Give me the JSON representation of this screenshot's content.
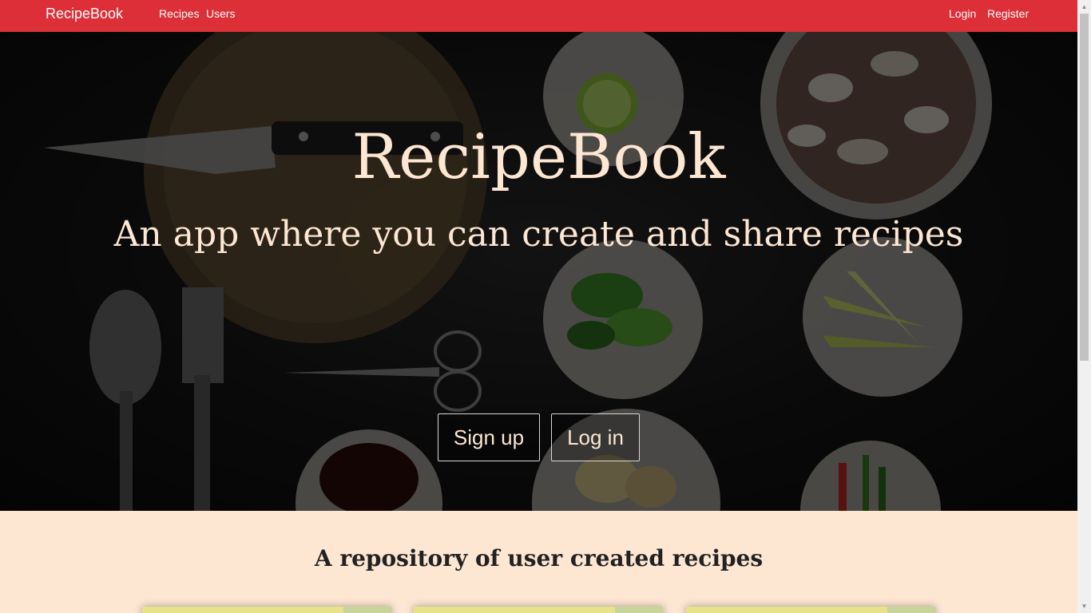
{
  "navbar": {
    "brand": "RecipeBook",
    "links": {
      "recipes": "Recipes",
      "users": "Users"
    },
    "auth": {
      "login": "Login",
      "register": "Register"
    },
    "color": "#dc2f38"
  },
  "hero": {
    "title": "RecipeBook",
    "subtitle": "An app where you can create and share recipes",
    "buttons": {
      "signup": "Sign up",
      "login": "Log in"
    },
    "text_color": "#fde6d2"
  },
  "main": {
    "heading": "A repository of user created recipes",
    "background": "#fde6d2"
  }
}
